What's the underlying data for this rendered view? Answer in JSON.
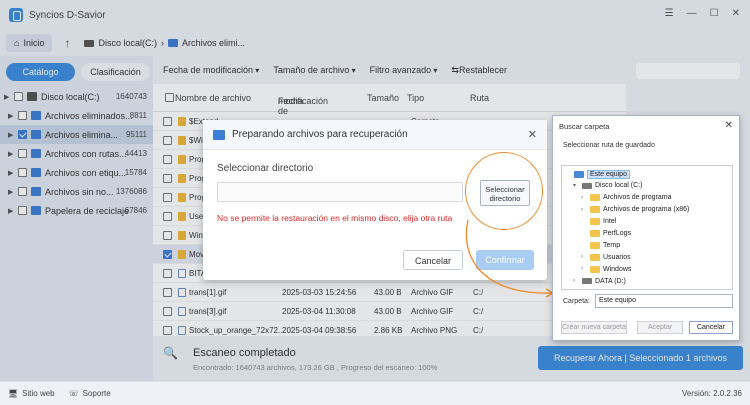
{
  "app": {
    "title": "Syncios D-Savior"
  },
  "nav": {
    "home": "Inicio",
    "crumb1": "Disco local(C:)",
    "crumb2": "Archivos elimi..."
  },
  "left_tabs": {
    "catalog": "Catálogo",
    "classification": "Clasificación"
  },
  "tree": [
    {
      "label": "Disco local(C:)",
      "count": "1640743",
      "color": "#555555",
      "checked": false,
      "indent": 0
    },
    {
      "label": "Archivos eliminados...",
      "count": "8811",
      "color": "#3d7fd6",
      "checked": false,
      "indent": 1
    },
    {
      "label": "Archivos elimina...",
      "count": "95111",
      "color": "#3d7fd6",
      "checked": true,
      "indent": 1,
      "selected": true
    },
    {
      "label": "Archivos con rutas...",
      "count": "44413",
      "color": "#3d7fd6",
      "checked": false,
      "indent": 1
    },
    {
      "label": "Archivos con etiqu...",
      "count": "15784",
      "color": "#3d7fd6",
      "checked": false,
      "indent": 1
    },
    {
      "label": "Archivos sin no...",
      "count": "1376086",
      "color": "#3d7fd6",
      "checked": false,
      "indent": 1
    },
    {
      "label": "Papelera de reciclaje",
      "count": "67846",
      "color": "#3d7fd6",
      "checked": false,
      "indent": 1
    }
  ],
  "filters": {
    "date": "Fecha de modificación",
    "size": "Tamaño de archivo",
    "advanced": "Filtro avanzado",
    "reset": "Restablecer"
  },
  "table_header": {
    "name": "Nombre de archivo",
    "date_line1": "Fecha de",
    "date_line2": "modificación",
    "size": "Tamaño",
    "type": "Tipo",
    "path": "Ruta"
  },
  "rows": [
    {
      "name": "$Extend",
      "date": "",
      "size": "",
      "type": "Carpeta",
      "path": "",
      "folder": true,
      "selected": false
    },
    {
      "name": "$Wi",
      "date": "",
      "size": "",
      "type": "",
      "path": "",
      "folder": true,
      "selected": false
    },
    {
      "name": "Prog",
      "date": "",
      "size": "",
      "type": "",
      "path": "",
      "folder": true,
      "selected": false
    },
    {
      "name": "Prog",
      "date": "",
      "size": "",
      "type": "",
      "path": "",
      "folder": true,
      "selected": false
    },
    {
      "name": "Prog",
      "date": "",
      "size": "",
      "type": "",
      "path": "",
      "folder": true,
      "selected": false
    },
    {
      "name": "User",
      "date": "",
      "size": "",
      "type": "",
      "path": "",
      "folder": true,
      "selected": false
    },
    {
      "name": "Wind",
      "date": "",
      "size": "",
      "type": "",
      "path": "",
      "folder": true,
      "selected": false
    },
    {
      "name": "Mov",
      "date": "",
      "size": "",
      "type": "",
      "path": "",
      "folder": true,
      "selected": true
    },
    {
      "name": "BITA",
      "date": "",
      "size": "",
      "type": "",
      "path": "",
      "folder": false,
      "selected": false
    },
    {
      "name": "trans[1].gif",
      "date": "2025-03-03 15:24:56",
      "size": "43.00 B",
      "type": "Archivo GIF",
      "path": "C:/",
      "folder": false,
      "selected": false
    },
    {
      "name": "trans[3].gif",
      "date": "2025-03-04 11:30:08",
      "size": "43.00 B",
      "type": "Archivo GIF",
      "path": "C:/",
      "folder": false,
      "selected": false
    },
    {
      "name": "Stock_up_orange_72x72...",
      "date": "2025-03-04 09:38:56",
      "size": "2.86 KB",
      "type": "Archivo PNG",
      "path": "C:/",
      "folder": false,
      "selected": false
    }
  ],
  "scan": {
    "title": "Escaneo completado",
    "subtitle": "Encontrado: 1640743 archivos, 173.26 GB , Progreso del escaneo: 100%"
  },
  "recover_button": "Recuperar Ahora | Seleccionado 1 archivos",
  "status": {
    "website": "Sitio web",
    "support": "Soporte",
    "version": "Versión: 2.0.2.36"
  },
  "dialog": {
    "title": "Preparando archivos para recuperación",
    "label": "Seleccionar directorio",
    "input_value": "",
    "select_button": "Seleccionar directorio",
    "error": "No se permite la restauración en el mismo disco, elija otra ruta",
    "cancel": "Cancelar",
    "confirm": "Confirmar"
  },
  "folder_dialog": {
    "title": "Buscar carpeta",
    "subtitle": "Seleccionar ruta de guardado",
    "tree": [
      {
        "label": "Este equipo",
        "icon": "pc",
        "indent": 0,
        "expander": "",
        "selected": true
      },
      {
        "label": "Disco local (C:)",
        "icon": "drive",
        "indent": 1,
        "expander": "▾",
        "selected": false
      },
      {
        "label": "Archivos de programa",
        "icon": "folder",
        "indent": 2,
        "expander": "›",
        "selected": false
      },
      {
        "label": "Archivos de programa (x86)",
        "icon": "folder",
        "indent": 2,
        "expander": "›",
        "selected": false
      },
      {
        "label": "Intel",
        "icon": "folder",
        "indent": 2,
        "expander": "",
        "selected": false
      },
      {
        "label": "PerfLogs",
        "icon": "folder",
        "indent": 2,
        "expander": "",
        "selected": false
      },
      {
        "label": "Temp",
        "icon": "folder",
        "indent": 2,
        "expander": "",
        "selected": false
      },
      {
        "label": "Usuarios",
        "icon": "folder",
        "indent": 2,
        "expander": "›",
        "selected": false
      },
      {
        "label": "Windows",
        "icon": "folder",
        "indent": 2,
        "expander": "›",
        "selected": false
      },
      {
        "label": "DATA (D:)",
        "icon": "drive",
        "indent": 1,
        "expander": "›",
        "selected": false
      }
    ],
    "folder_label": "Carpeta:",
    "folder_value": "Este equipo",
    "new_folder": "Crear nueva carpeta",
    "accept": "Aceptar",
    "cancel": "Cancelar"
  },
  "colors": {
    "accent": "#3d8fe0",
    "error": "#d62b2b",
    "highlight_ring": "#f08a2a"
  }
}
